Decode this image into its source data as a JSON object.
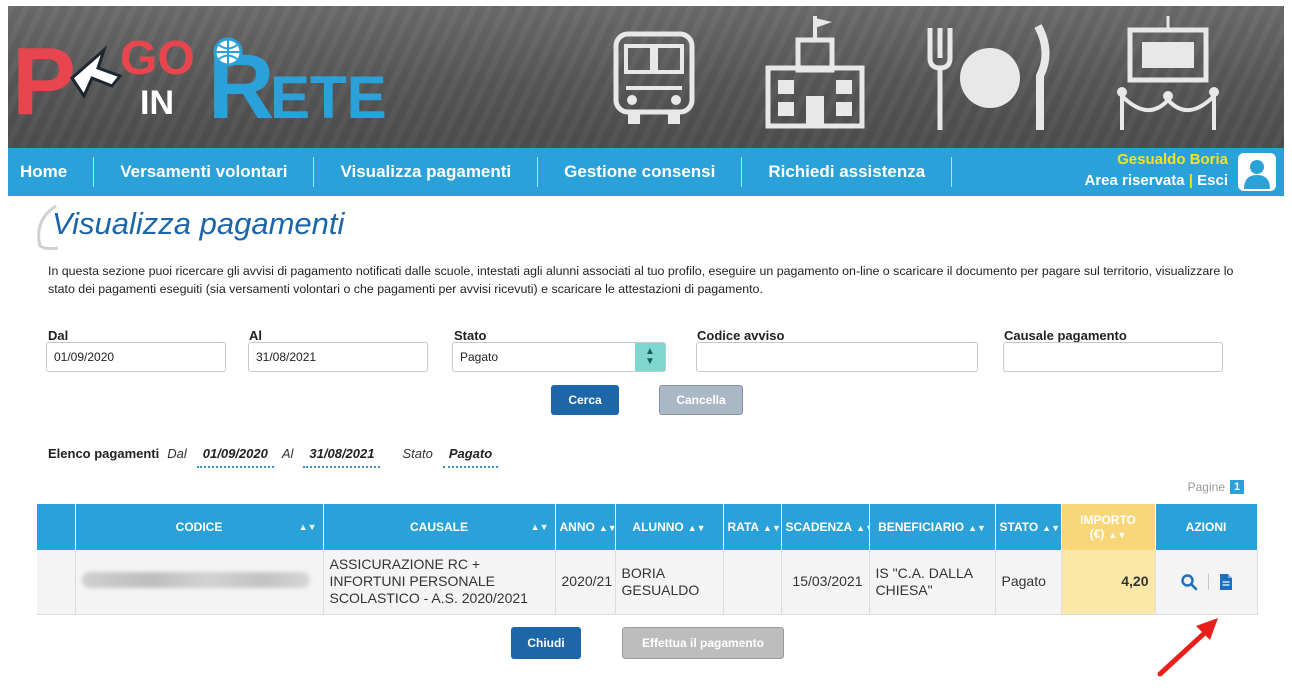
{
  "header": {
    "logo_letters": [
      "P",
      "GO",
      "IN",
      "R",
      "ETE"
    ],
    "logo_text": "PAGO IN RETE"
  },
  "nav": {
    "items": [
      "Home",
      "Versamenti volontari",
      "Visualizza pagamenti",
      "Gestione consensi",
      "Richiedi assistenza"
    ],
    "user_name": "Gesualdo Boria",
    "area_riservata": "Area riservata",
    "separator": "|",
    "esci": "Esci"
  },
  "page": {
    "title": "Visualizza pagamenti",
    "intro": "In questa sezione puoi ricercare gli avvisi di pagamento notificati dalle scuole, intestati agli alunni associati al tuo profilo, eseguire un pagamento on-line o scaricare il documento per pagare sul territorio, visualizzare lo stato dei pagamenti eseguiti (sia versamenti volontari o che pagamenti per avvisi ricevuti) e scaricare le attestazioni di pagamento."
  },
  "filters": {
    "dal_label": "Dal",
    "dal_value": "01/09/2020",
    "al_label": "Al",
    "al_value": "31/08/2021",
    "stato_label": "Stato",
    "stato_value": "Pagato",
    "codice_label": "Codice avviso",
    "codice_value": "",
    "causale_label": "Causale pagamento",
    "causale_value": "",
    "cerca": "Cerca",
    "cancella": "Cancella"
  },
  "summary": {
    "title": "Elenco pagamenti",
    "dal_label": "Dal",
    "dal_value": "01/09/2020",
    "al_label": "Al",
    "al_value": "31/08/2021",
    "stato_label": "Stato",
    "stato_value": "Pagato"
  },
  "pagination": {
    "label": "Pagine",
    "current": "1"
  },
  "table": {
    "headers": {
      "codice": "CODICE",
      "causale": "CAUSALE",
      "anno": "ANNO",
      "alunno": "ALUNNO",
      "rata": "RATA",
      "scadenza": "SCADENZA",
      "beneficiario": "BENEFICIARIO",
      "stato": "STATO",
      "importo": "IMPORTO (€)",
      "azioni": "AZIONI"
    },
    "rows": [
      {
        "causale": "ASSICURAZIONE RC + INFORTUNI PERSONALE SCOLASTICO - A.S. 2020/2021",
        "anno": "2020/21",
        "alunno": "BORIA GESUALDO",
        "rata": "",
        "scadenza": "15/03/2021",
        "beneficiario": "IS \"C.A. DALLA CHIESA\"",
        "stato": "Pagato",
        "importo": "4,20",
        "actions": [
          "search-icon",
          "document-icon"
        ]
      }
    ]
  },
  "footer_buttons": {
    "chiudi": "Chiudi",
    "effettua": "Effettua il pagamento"
  },
  "colors": {
    "nav": "#2aa1d8",
    "title": "#1c65a9",
    "primary_button": "#1d67a8",
    "importo_bg": "#fbe7a8",
    "annotation_arrow": "#e8201c"
  }
}
